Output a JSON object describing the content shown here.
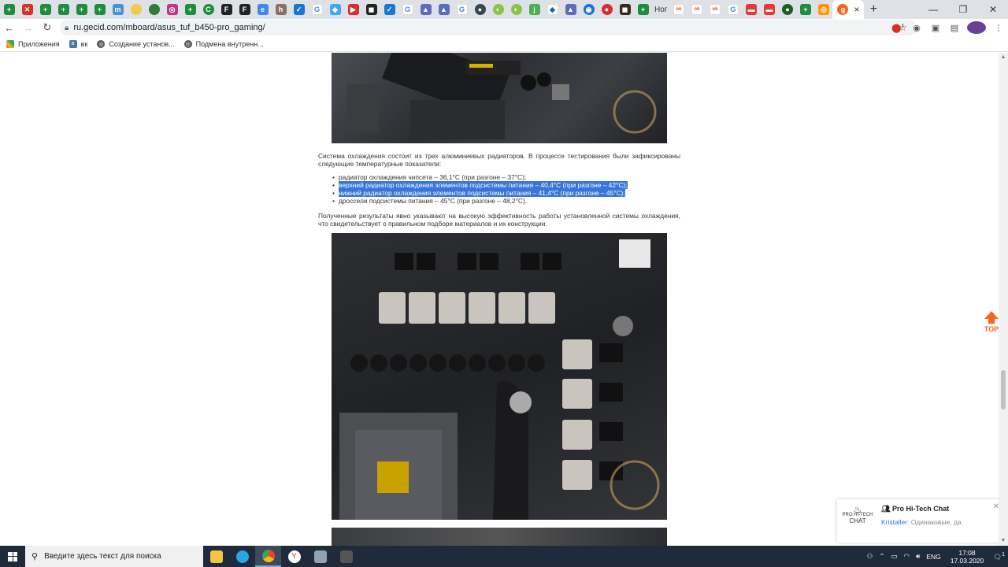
{
  "browser": {
    "active_tab_close": "×",
    "text_tab_1": "Ног",
    "new_tab": "+",
    "url": "ru.gecid.com/mboard/asus_tuf_b450-pro_gaming/",
    "avatar_letter": "A",
    "ext_badge": "1"
  },
  "bookmarks": [
    {
      "label": "Приложения"
    },
    {
      "label": "вк"
    },
    {
      "label": "Создание установ..."
    },
    {
      "label": "Подмена внутренн..."
    }
  ],
  "article": {
    "para1": "Система охлаждения состоит из трех алюминиевых радиаторов. В процессе тестирования были зафиксированы следующие температурные показатели:",
    "list": [
      "радиатор охлаждения чипсета – 36,1°C (при разгоне – 37°C);",
      "верхний радиатор охлаждения элементов подсистемы питания – 40,4°C (при разгоне – 42°C);",
      "нижний радиатор охлаждения элементов подсистемы питания – 41,4°C (при разгоне – 45°C);",
      "дроссели подсистемы питания – 45°C (при разгоне – 48,2°C)."
    ],
    "para2": "Полученные результаты явно указывают на высокую эффективность работы установленной системы охлаждения, что свидетельствует о правильном подборе материалов и их конструкции."
  },
  "top_button": "TOP",
  "chat": {
    "logo_line1": "PRO HI-TECH",
    "logo_line2": "CHAT",
    "title": "Pro Hi-Tech Chat",
    "author": "Kristaller:",
    "message": "Одинаковые, да"
  },
  "taskbar": {
    "search_placeholder": "Введите здесь текст для поиска",
    "lang": "ENG",
    "time": "17:08",
    "date": "17.03.2020",
    "notif_count": "1"
  },
  "colors": {
    "selection": "#3875d7",
    "accent_top": "#f26522",
    "taskbar_bg": "#1f2a3a"
  }
}
